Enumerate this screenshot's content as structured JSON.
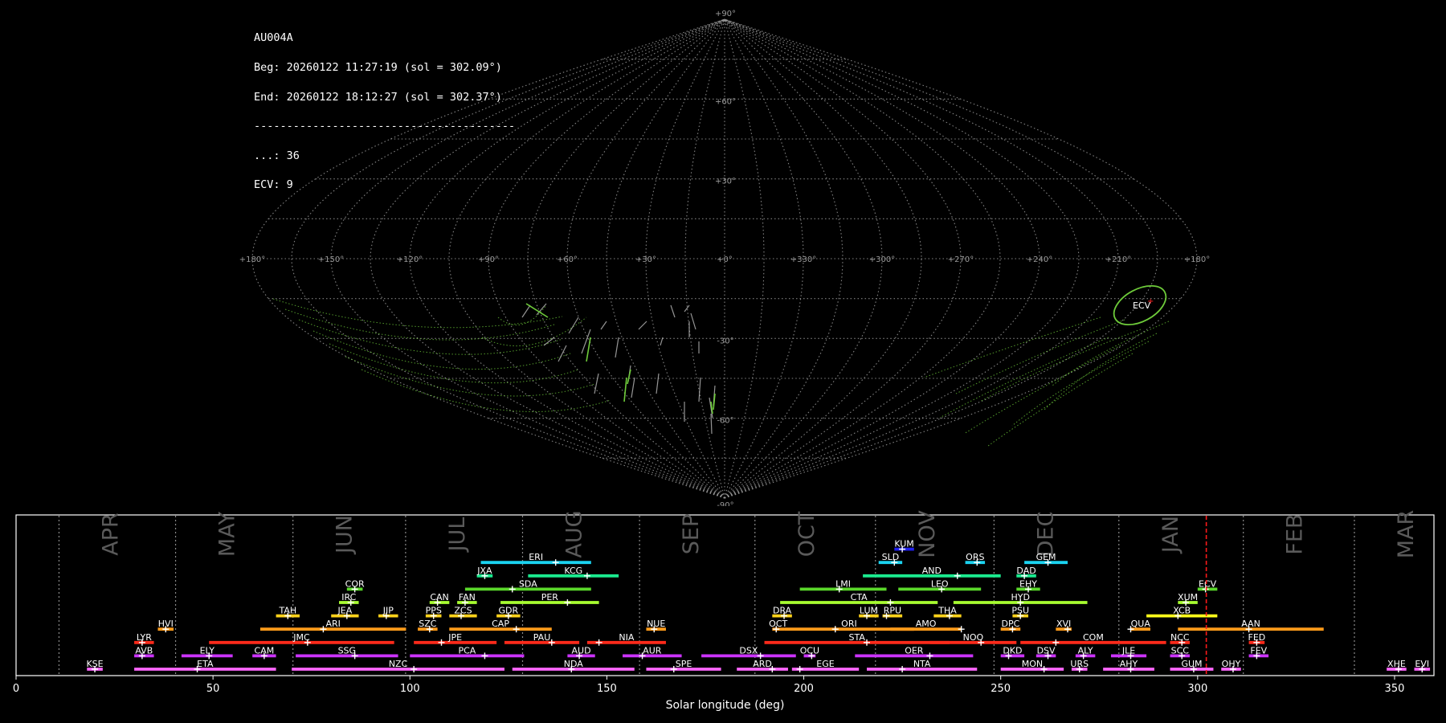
{
  "info": {
    "station": "AU004A",
    "beg": "Beg: 20260122 11:27:19 (sol = 302.09°)",
    "end": "End: 20260122 18:12:27 (sol = 302.37°)",
    "separator": "----------------------------------------",
    "sporadic_count": "...: 36",
    "shower_count": "ECV: 9"
  },
  "chart_data": [
    {
      "type": "scatter",
      "name": "sky-map",
      "projection": "sinusoidal",
      "colors": {
        "grid": "#9a9a9a",
        "meteor": "#6ecb3a",
        "shower_ellipse": "#6ecb3a",
        "radiant": "#ff2020"
      },
      "lat_labels": [
        "+90°",
        "+60°",
        "+30°",
        "-30°",
        "-60°",
        "-90°"
      ],
      "lon_labels": [
        "+180°",
        "+150°",
        "+120°",
        "+90°",
        "+60°",
        "+30°",
        "+0°",
        "+330°",
        "+300°",
        "+270°",
        "+240°",
        "+210°",
        "+180°"
      ],
      "shower_label": "ECV",
      "shower_radiant": {
        "lon": 197,
        "lat": -12
      }
    },
    {
      "type": "timeline",
      "name": "shower-calendar",
      "xlabel": "Solar longitude (deg)",
      "xlim": [
        0,
        360
      ],
      "xticks": [
        0,
        50,
        100,
        150,
        200,
        250,
        300,
        350
      ],
      "current_sol": 302.2,
      "months": [
        {
          "label": "APR",
          "start": 10.9
        },
        {
          "label": "MAY",
          "start": 40.5
        },
        {
          "label": "JUN",
          "start": 70.3
        },
        {
          "label": "JUL",
          "start": 98.9
        },
        {
          "label": "AUG",
          "start": 128.6
        },
        {
          "label": "SEP",
          "start": 158.3
        },
        {
          "label": "OCT",
          "start": 187.6
        },
        {
          "label": "NOV",
          "start": 218.2
        },
        {
          "label": "DEC",
          "start": 248.3
        },
        {
          "label": "JAN",
          "start": 280.0
        },
        {
          "label": "FEB",
          "start": 311.6
        },
        {
          "label": "MAR",
          "start": 339.8
        }
      ],
      "showers": [
        {
          "code": "KSE",
          "start": 18,
          "end": 22,
          "peak": 20,
          "row": 0,
          "color": "#ff66ff"
        },
        {
          "code": "ETA",
          "start": 30,
          "end": 66,
          "peak": 46,
          "row": 0,
          "color": "#ff66ff"
        },
        {
          "code": "NZC",
          "start": 70,
          "end": 124,
          "peak": 101,
          "row": 0,
          "color": "#ff66ff"
        },
        {
          "code": "NDA",
          "start": 126,
          "end": 157,
          "peak": 141,
          "row": 0,
          "color": "#ff66ff"
        },
        {
          "code": "SPE",
          "start": 160,
          "end": 179,
          "peak": 167,
          "row": 0,
          "color": "#ff66ff"
        },
        {
          "code": "ARD",
          "start": 183,
          "end": 196,
          "peak": 192,
          "row": 0,
          "color": "#ff66ff"
        },
        {
          "code": "EGE",
          "start": 197,
          "end": 214,
          "peak": 199,
          "row": 0,
          "color": "#ff66ff"
        },
        {
          "code": "NTA",
          "start": 216,
          "end": 244,
          "peak": 225,
          "row": 0,
          "color": "#ff66ff"
        },
        {
          "code": "MON",
          "start": 250,
          "end": 266,
          "peak": 261,
          "row": 0,
          "color": "#ff66ff"
        },
        {
          "code": "URS",
          "start": 268,
          "end": 272,
          "peak": 270,
          "row": 0,
          "color": "#ff66ff"
        },
        {
          "code": "AHY",
          "start": 276,
          "end": 289,
          "peak": 283,
          "row": 0,
          "color": "#ff66ff"
        },
        {
          "code": "GUM",
          "start": 293,
          "end": 304,
          "peak": 299,
          "row": 0,
          "color": "#ff66ff"
        },
        {
          "code": "OHY",
          "start": 306,
          "end": 311,
          "peak": 309,
          "row": 0,
          "color": "#ff66ff"
        },
        {
          "code": "XHE",
          "start": 348,
          "end": 353,
          "peak": 351,
          "row": 0,
          "color": "#ff66ff"
        },
        {
          "code": "EVI",
          "start": 355,
          "end": 359,
          "peak": 357,
          "row": 0,
          "color": "#ff66ff"
        },
        {
          "code": "AVB",
          "start": 30,
          "end": 35,
          "peak": 32,
          "row": 1,
          "color": "#cc33ff"
        },
        {
          "code": "ELY",
          "start": 42,
          "end": 55,
          "peak": 49,
          "row": 1,
          "color": "#cc33ff"
        },
        {
          "code": "CAM",
          "start": 60,
          "end": 66,
          "peak": 63,
          "row": 1,
          "color": "#cc33ff"
        },
        {
          "code": "SSG",
          "start": 71,
          "end": 97,
          "peak": 86,
          "row": 1,
          "color": "#cc33ff"
        },
        {
          "code": "PCA",
          "start": 100,
          "end": 129,
          "peak": 119,
          "row": 1,
          "color": "#cc33ff"
        },
        {
          "code": "AUD",
          "start": 140,
          "end": 147,
          "peak": 143,
          "row": 1,
          "color": "#cc33ff"
        },
        {
          "code": "AUR",
          "start": 154,
          "end": 169,
          "peak": 159,
          "row": 1,
          "color": "#cc33ff"
        },
        {
          "code": "DSX",
          "start": 174,
          "end": 198,
          "peak": 189,
          "row": 1,
          "color": "#cc33ff"
        },
        {
          "code": "OCU",
          "start": 200,
          "end": 203,
          "peak": 202,
          "row": 1,
          "color": "#cc33ff"
        },
        {
          "code": "OER",
          "start": 213,
          "end": 243,
          "peak": 232,
          "row": 1,
          "color": "#cc33ff"
        },
        {
          "code": "DKD",
          "start": 250,
          "end": 256,
          "peak": 252,
          "row": 1,
          "color": "#cc33ff"
        },
        {
          "code": "DSV",
          "start": 259,
          "end": 264,
          "peak": 262,
          "row": 1,
          "color": "#cc33ff"
        },
        {
          "code": "ALY",
          "start": 269,
          "end": 274,
          "peak": 271,
          "row": 1,
          "color": "#cc33ff"
        },
        {
          "code": "JLE",
          "start": 278,
          "end": 287,
          "peak": 283,
          "row": 1,
          "color": "#cc33ff"
        },
        {
          "code": "SCC",
          "start": 293,
          "end": 298,
          "peak": 296,
          "row": 1,
          "color": "#cc33ff"
        },
        {
          "code": "FEV",
          "start": 313,
          "end": 318,
          "peak": 315,
          "row": 1,
          "color": "#cc33ff"
        },
        {
          "code": "LYR",
          "start": 30,
          "end": 35,
          "peak": 32,
          "row": 2,
          "color": "#ff2a1a"
        },
        {
          "code": "JMC",
          "start": 49,
          "end": 96,
          "peak": 74,
          "row": 2,
          "color": "#ff2a1a"
        },
        {
          "code": "JPE",
          "start": 101,
          "end": 122,
          "peak": 108,
          "row": 2,
          "color": "#ff2a1a"
        },
        {
          "code": "PAU",
          "start": 124,
          "end": 143,
          "peak": 136,
          "row": 2,
          "color": "#ff2a1a"
        },
        {
          "code": "NIA",
          "start": 145,
          "end": 165,
          "peak": 148,
          "row": 2,
          "color": "#ff2a1a"
        },
        {
          "code": "STA",
          "start": 190,
          "end": 237,
          "peak": 216,
          "row": 2,
          "color": "#ff2a1a"
        },
        {
          "code": "NOO",
          "start": 232,
          "end": 254,
          "peak": 245,
          "row": 2,
          "color": "#ff2a1a"
        },
        {
          "code": "COM",
          "start": 255,
          "end": 292,
          "peak": 264,
          "row": 2,
          "color": "#ff2a1a"
        },
        {
          "code": "NCC",
          "start": 293,
          "end": 298,
          "peak": 296,
          "row": 2,
          "color": "#ff2a1a"
        },
        {
          "code": "FED",
          "start": 313,
          "end": 317,
          "peak": 315,
          "row": 2,
          "color": "#ff2a1a"
        },
        {
          "code": "HVI",
          "start": 36,
          "end": 40,
          "peak": 38,
          "row": 3,
          "color": "#ff9a1a"
        },
        {
          "code": "ARI",
          "start": 62,
          "end": 99,
          "peak": 78,
          "row": 3,
          "color": "#ff9a1a"
        },
        {
          "code": "SZC",
          "start": 102,
          "end": 107,
          "peak": 105,
          "row": 3,
          "color": "#ff9a1a"
        },
        {
          "code": "CAP",
          "start": 110,
          "end": 136,
          "peak": 127,
          "row": 3,
          "color": "#ff9a1a"
        },
        {
          "code": "NUE",
          "start": 160,
          "end": 165,
          "peak": 162,
          "row": 3,
          "color": "#ff9a1a"
        },
        {
          "code": "OCT",
          "start": 192,
          "end": 195,
          "peak": 193,
          "row": 3,
          "color": "#ff9a1a"
        },
        {
          "code": "ORI",
          "start": 195,
          "end": 228,
          "peak": 208,
          "row": 3,
          "color": "#ff9a1a"
        },
        {
          "code": "AMO",
          "start": 222,
          "end": 240,
          "peak": 240,
          "row": 3,
          "color": "#ff9a1a"
        },
        {
          "code": "DPC",
          "start": 250,
          "end": 255,
          "peak": 253,
          "row": 3,
          "color": "#ff9a1a"
        },
        {
          "code": "XVI",
          "start": 264,
          "end": 268,
          "peak": 267,
          "row": 3,
          "color": "#ff9a1a"
        },
        {
          "code": "QUA",
          "start": 283,
          "end": 288,
          "peak": 283,
          "row": 3,
          "color": "#ff9a1a"
        },
        {
          "code": "AAN",
          "start": 295,
          "end": 332,
          "peak": 313,
          "row": 3,
          "color": "#ff9a1a"
        },
        {
          "code": "TAH",
          "start": 66,
          "end": 72,
          "peak": 69,
          "row": 4,
          "color": "#ffd21a"
        },
        {
          "code": "JEA",
          "start": 80,
          "end": 87,
          "peak": 84,
          "row": 4,
          "color": "#ffd21a"
        },
        {
          "code": "JIP",
          "start": 92,
          "end": 97,
          "peak": 94,
          "row": 4,
          "color": "#ffd21a"
        },
        {
          "code": "PPS",
          "start": 104,
          "end": 108,
          "peak": 106,
          "row": 4,
          "color": "#ffd21a"
        },
        {
          "code": "ZCS",
          "start": 110,
          "end": 117,
          "peak": 113,
          "row": 4,
          "color": "#ffd21a"
        },
        {
          "code": "GDR",
          "start": 122,
          "end": 128,
          "peak": 125,
          "row": 4,
          "color": "#ffd21a"
        },
        {
          "code": "DRA",
          "start": 192,
          "end": 197,
          "peak": 195,
          "row": 4,
          "color": "#ffd21a"
        },
        {
          "code": "LUM",
          "start": 214,
          "end": 219,
          "peak": 216,
          "row": 4,
          "color": "#ffd21a"
        },
        {
          "code": "RPU",
          "start": 220,
          "end": 225,
          "peak": 221,
          "row": 4,
          "color": "#ffd21a"
        },
        {
          "code": "THA",
          "start": 233,
          "end": 240,
          "peak": 237,
          "row": 4,
          "color": "#ffd21a"
        },
        {
          "code": "PSU",
          "start": 253,
          "end": 257,
          "peak": 255,
          "row": 4,
          "color": "#ffd21a"
        },
        {
          "code": "XCB",
          "start": 287,
          "end": 305,
          "peak": 295,
          "row": 4,
          "color": "#ffff1a"
        },
        {
          "code": "IRC",
          "start": 82,
          "end": 87,
          "peak": 85,
          "row": 5,
          "color": "#a8ff30"
        },
        {
          "code": "CAN",
          "start": 105,
          "end": 110,
          "peak": 107,
          "row": 5,
          "color": "#a8ff30"
        },
        {
          "code": "FAN",
          "start": 112,
          "end": 117,
          "peak": 114,
          "row": 5,
          "color": "#a8ff30"
        },
        {
          "code": "PER",
          "start": 123,
          "end": 148,
          "peak": 140,
          "row": 5,
          "color": "#a8ff30"
        },
        {
          "code": "CTA",
          "start": 194,
          "end": 234,
          "peak": 222,
          "row": 5,
          "color": "#a8ff30"
        },
        {
          "code": "HYD",
          "start": 238,
          "end": 272,
          "peak": 255,
          "row": 5,
          "color": "#a8ff30"
        },
        {
          "code": "XUM",
          "start": 295,
          "end": 300,
          "peak": 297,
          "row": 5,
          "color": "#a8ff30"
        },
        {
          "code": "COR",
          "start": 84,
          "end": 88,
          "peak": 86,
          "row": 6,
          "color": "#5ad82a"
        },
        {
          "code": "SDA",
          "start": 114,
          "end": 146,
          "peak": 126,
          "row": 6,
          "color": "#5ad82a"
        },
        {
          "code": "LMI",
          "start": 199,
          "end": 221,
          "peak": 209,
          "row": 6,
          "color": "#5ad82a"
        },
        {
          "code": "LEO",
          "start": 224,
          "end": 245,
          "peak": 235,
          "row": 6,
          "color": "#5ad82a"
        },
        {
          "code": "EHY",
          "start": 254,
          "end": 260,
          "peak": 257,
          "row": 6,
          "color": "#5ad82a"
        },
        {
          "code": "ECV",
          "start": 300,
          "end": 305,
          "peak": 302,
          "row": 6,
          "color": "#5ad82a"
        },
        {
          "code": "JXA",
          "start": 117,
          "end": 121,
          "peak": 119,
          "row": 7,
          "color": "#1aeb8f"
        },
        {
          "code": "KCG",
          "start": 130,
          "end": 153,
          "peak": 145,
          "row": 7,
          "color": "#1aeb8f"
        },
        {
          "code": "AND",
          "start": 215,
          "end": 250,
          "peak": 239,
          "row": 7,
          "color": "#1aeb8f"
        },
        {
          "code": "DAD",
          "start": 254,
          "end": 259,
          "peak": 256,
          "row": 7,
          "color": "#1aeb8f"
        },
        {
          "code": "ERI",
          "start": 118,
          "end": 146,
          "peak": 137,
          "row": 8,
          "color": "#1ad2f0"
        },
        {
          "code": "SLD",
          "start": 219,
          "end": 225,
          "peak": 223,
          "row": 8,
          "color": "#1ad2f0"
        },
        {
          "code": "ORS",
          "start": 241,
          "end": 246,
          "peak": 244,
          "row": 8,
          "color": "#1ad2f0"
        },
        {
          "code": "GEM",
          "start": 256,
          "end": 267,
          "peak": 262,
          "row": 8,
          "color": "#1ad2f0"
        },
        {
          "code": "KUM",
          "start": 223,
          "end": 228,
          "peak": 225,
          "row": 9,
          "color": "#2020ee"
        }
      ]
    }
  ]
}
